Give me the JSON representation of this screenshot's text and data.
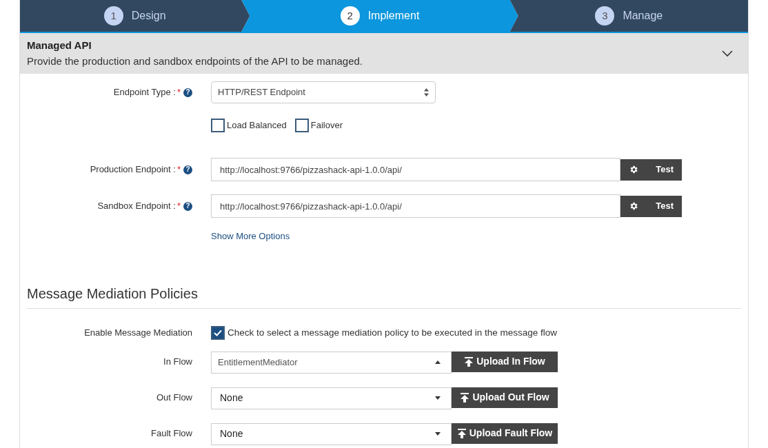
{
  "wizard": {
    "steps": [
      {
        "number": "1",
        "label": "Design",
        "selected": false
      },
      {
        "number": "2",
        "label": "Implement",
        "selected": true
      },
      {
        "number": "3",
        "label": "Manage",
        "selected": false
      }
    ]
  },
  "panel": {
    "title": "Managed API",
    "description": "Provide the production and sandbox endpoints of the API to be managed.",
    "expanded": true
  },
  "endpoint_type": {
    "label": "Endpoint Type :",
    "required": "*",
    "help": "?",
    "value": "HTTP/REST Endpoint"
  },
  "endpoint_options": [
    {
      "label": "Load Balanced",
      "checked": false
    },
    {
      "label": "Failover",
      "checked": false
    }
  ],
  "endpoints": [
    {
      "label": "Production Endpoint :",
      "required": "*",
      "help": "?",
      "value": "http://localhost:9766/pizzashack-api-1.0.0/api/",
      "button": "Test"
    },
    {
      "label": "Sandbox Endpoint :",
      "required": "*",
      "help": "?",
      "value": "http://localhost:9766/pizzashack-api-1.0.0/api/",
      "button": "Test"
    }
  ],
  "show_more_link": "Show More Options",
  "mediation": {
    "heading": "Message Mediation Policies",
    "enable_label": "Enable Message Mediation",
    "enable_checked": true,
    "enable_text": "Check to select a message mediation policy to be executed in the message flow",
    "flows": [
      {
        "label": "In Flow",
        "value": "EntitlementMediator",
        "expanded": true,
        "button": "Upload In Flow"
      },
      {
        "label": "Out Flow",
        "value": "None",
        "expanded": false,
        "button": "Upload Out Flow"
      },
      {
        "label": "Fault Flow",
        "value": "None",
        "expanded": false,
        "button": "Upload Fault Flow"
      }
    ]
  }
}
